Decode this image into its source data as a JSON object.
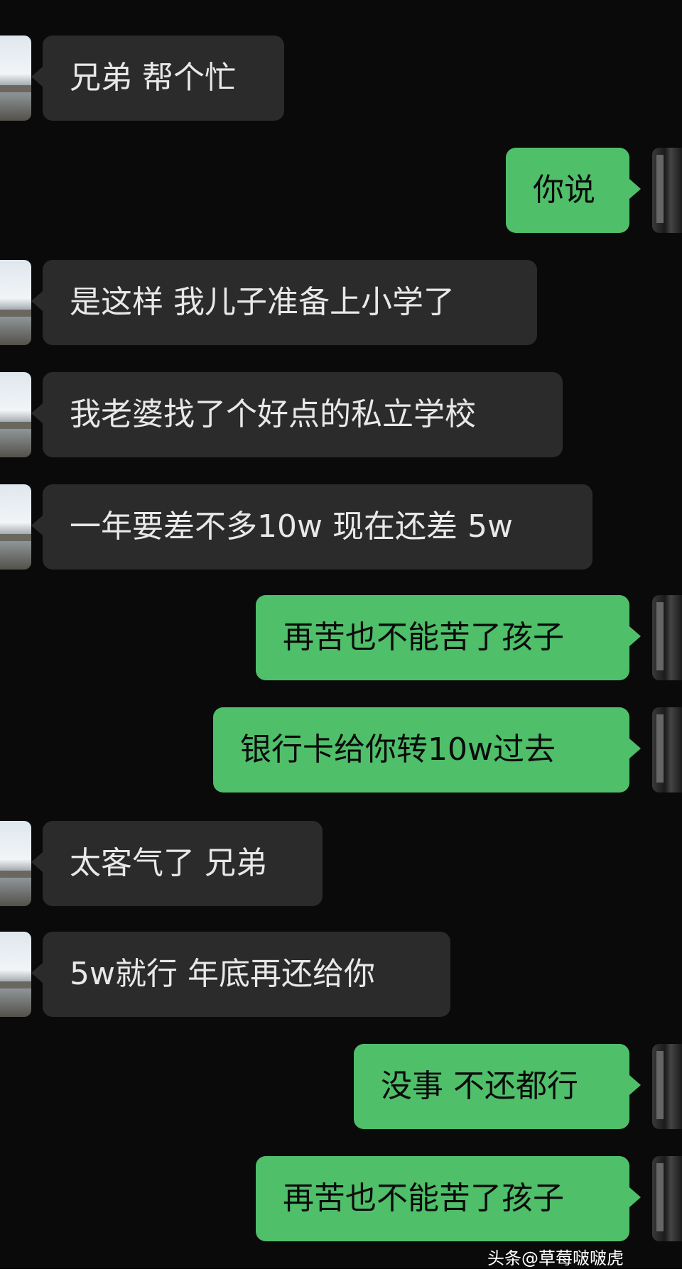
{
  "messages": [
    {
      "side": "left",
      "text": "兄弟 帮个忙"
    },
    {
      "side": "right",
      "text": "你说"
    },
    {
      "side": "left",
      "text": "是这样 我儿子准备上小学了"
    },
    {
      "side": "left",
      "text": "我老婆找了个好点的私立学校"
    },
    {
      "side": "left",
      "text": "一年要差不多10w 现在还差 5w"
    },
    {
      "side": "right",
      "text": "再苦也不能苦了孩子"
    },
    {
      "side": "right",
      "text": "银行卡给你转10w过去"
    },
    {
      "side": "left",
      "text": "太客气了 兄弟"
    },
    {
      "side": "left",
      "text": "5w就行 年底再还给你"
    },
    {
      "side": "right",
      "text": "没事 不还都行"
    },
    {
      "side": "right",
      "text": "再苦也不能苦了孩子"
    }
  ],
  "watermark": "头条@草莓啵啵虎",
  "colors": {
    "background": "#0a0a0a",
    "incoming_bubble": "#2b2b2b",
    "outgoing_bubble": "#4fbf6a"
  },
  "icons": {
    "left_avatar": "avatar",
    "right_avatar": "avatar"
  }
}
